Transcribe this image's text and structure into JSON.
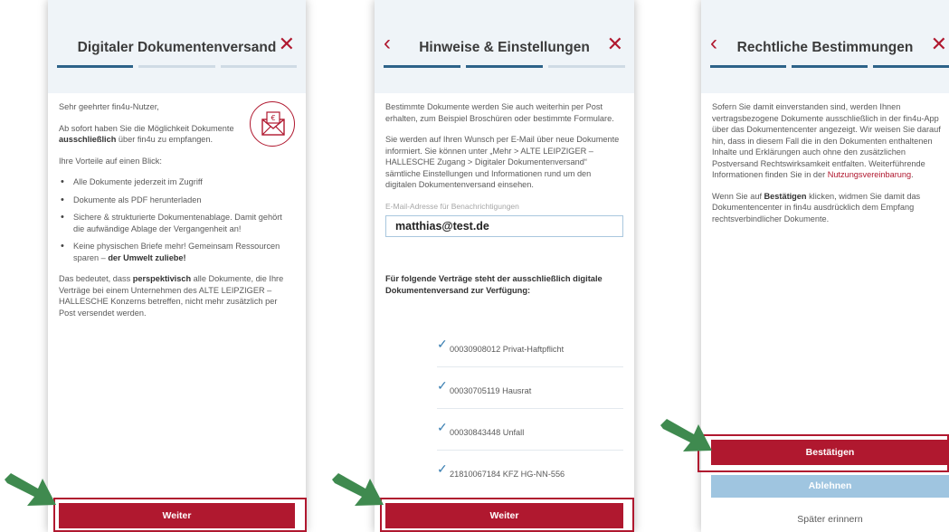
{
  "screen1": {
    "title": "Digitaler Dokumentenversand",
    "close_glyph": "✕",
    "greeting": "Sehr geehrter fin4u-Nutzer,",
    "intro_a": "Ab sofort haben Sie die Möglichkeit Dokumente ",
    "intro_b": "ausschließlich",
    "intro_c": " über fin4u zu empfangen.",
    "benefits_heading": "Ihre Vorteile auf einen Blick:",
    "benefits": [
      "Alle Dokumente jederzeit im Zugriff",
      "Dokumente als PDF herunterladen",
      "Sichere & strukturierte Dokumentenablage. Damit gehört die aufwändige Ablage der Vergangenheit an!"
    ],
    "benefit4_a": "Keine physischen Briefe mehr! Gemeinsam Ressourcen sparen – ",
    "benefit4_b": "der Umwelt zuliebe!",
    "outro_a": "Das bedeutet, dass ",
    "outro_b": "perspektivisch",
    "outro_c": " alle Dokumente, die Ihre Verträge bei einem Unternehmen des ALTE LEIPZIGER – HALLESCHE Konzerns betreffen, nicht mehr zusätzlich per Post versendet werden.",
    "button": "Weiter",
    "envelope_icon": "envelope-euro-icon"
  },
  "screen2": {
    "title": "Hinweise & Einstellungen",
    "back_glyph": "‹",
    "close_glyph": "✕",
    "para1": "Bestimmte Dokumente werden Sie auch weiterhin per Post erhalten, zum Beispiel Broschüren oder bestimmte Formulare.",
    "para2": "Sie werden auf Ihren Wunsch per E-Mail über neue Dokumente informiert. Sie können unter „Mehr > ALTE LEIPZIGER – HALLESCHE Zugang > Digitaler Dokumentenversand“ sämtliche Einstellungen und Informationen rund um den digitalen Dokumentenversand einsehen.",
    "email_label": "E-Mail-Adresse für Benachrichtigungen",
    "email_value": "matthias@test.de",
    "contracts_heading": "Für folgende Verträge steht der ausschließlich digitale Dokumentenversand zur Verfügung:",
    "contracts": [
      "00030908012 Privat-Haftpflicht",
      "00030705119 Hausrat",
      "00030843448 Unfall",
      "21810067184 KFZ HG-NN-556"
    ],
    "check_glyph": "✓",
    "button": "Weiter"
  },
  "screen3": {
    "title": "Rechtliche Bestimmungen",
    "back_glyph": "‹",
    "close_glyph": "✕",
    "para1": "Sofern Sie damit einverstanden sind, werden Ihnen vertragsbezogene Dokumente ausschließlich in der fin4u-App über das Dokumentencenter angezeigt. Wir weisen Sie darauf hin, dass in diesem Fall die in den Dokumenten enthaltenen Inhalte und Erklärungen auch ohne den zusätzlichen Postversand Rechtswirksamkeit entfalten. Weiterführende Informationen finden Sie in der ",
    "para1_link": "Nutzungsvereinbarung",
    "para1_end": ".",
    "para2_a": "Wenn Sie auf ",
    "para2_b": "Bestätigen",
    "para2_c": " klicken, widmen Sie damit das Dokumentencenter in fin4u ausdrücklich dem Empfang rechtsverbindlicher Dokumente.",
    "confirm_button": "Bestätigen",
    "decline_button": "Ablehnen",
    "later_link": "Später erinnern"
  },
  "colors": {
    "accent": "#b0182f",
    "progress_active": "#2d6389",
    "header_bg": "#eff4f8",
    "arrow": "#3f8a4f",
    "decline_bg": "#9fc5e0"
  }
}
